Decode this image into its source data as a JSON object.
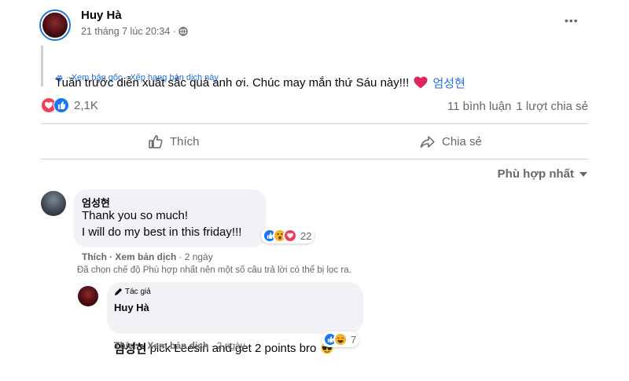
{
  "post": {
    "author": "Huy Hà",
    "timestamp": "21 tháng 7 lúc 20:34 ·",
    "audience_icon": "globe-icon",
    "more_icon": "more-options-icon",
    "more_text": "•••",
    "text": "Tuần trước diễn xuất sắc quá anh ơi. Chúc may mắn thứ Sáu này!!! ",
    "mention": "엄성현",
    "translation_links": "· Xem bản gốc · Xếp hạng bản dịch này",
    "reaction_count": "2,1K",
    "comment_count": "11 bình luận",
    "share_count": "1 lượt chia sẻ",
    "like_label": "Thích",
    "share_label": "Chia sẻ",
    "sort_label": "Phù hợp nhất"
  },
  "comments": [
    {
      "author": "엄성현",
      "lines": [
        "Thank you so much!",
        "I will do my best in this friday!!!"
      ],
      "reaction_count": "22",
      "like": "Thích",
      "translate": "· Xem bản dịch",
      "time": "· 2 ngày",
      "filter_note": "Đã chọn chế độ Phù hợp nhất nên một số câu trả lời có thể bị lọc ra."
    }
  ],
  "reply": {
    "badge": "Tác giả",
    "author": "Huy Hà",
    "mention": "엄성현",
    "text": " pick Leesin and get 2 points bro",
    "reaction_count": "7",
    "like": "Thích",
    "translate": "· Xem bản dịch",
    "time": "· 2 ngày"
  },
  "colors": {
    "brand_blue": "#1b74e4",
    "like_blue": "#1877f2",
    "love_red": "#f33e58",
    "wow_yellow": "#f7b125",
    "text_muted": "#65676b",
    "divider": "#ced0d4"
  }
}
